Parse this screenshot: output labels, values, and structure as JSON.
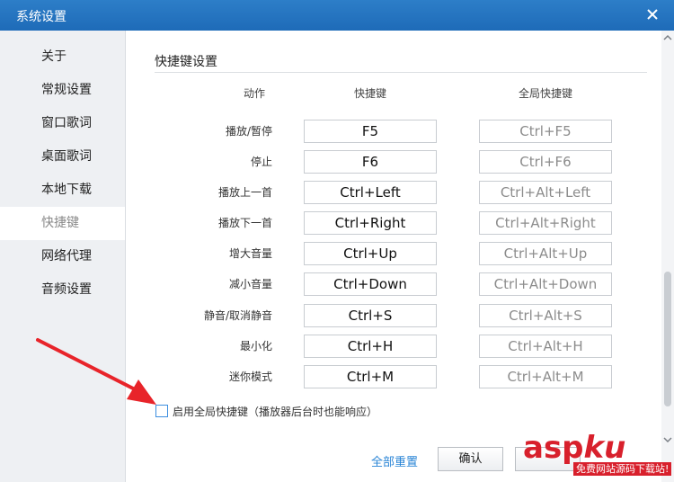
{
  "window": {
    "title": "系统设置",
    "icons": {
      "close": "close-icon"
    }
  },
  "sidebar": {
    "items": [
      {
        "label": "关于"
      },
      {
        "label": "常规设置"
      },
      {
        "label": "窗口歌词"
      },
      {
        "label": "桌面歌词"
      },
      {
        "label": "本地下载"
      },
      {
        "label": "快捷键",
        "active": true
      },
      {
        "label": "网络代理"
      },
      {
        "label": "音频设置"
      }
    ]
  },
  "section": {
    "title": "快捷键设置"
  },
  "table": {
    "headers": {
      "action": "动作",
      "shortcut": "快捷键",
      "global": "全局快捷键"
    },
    "rows": [
      {
        "action": "播放/暂停",
        "shortcut": "F5",
        "global": "Ctrl+F5"
      },
      {
        "action": "停止",
        "shortcut": "F6",
        "global": "Ctrl+F6"
      },
      {
        "action": "播放上一首",
        "shortcut": "Ctrl+Left",
        "global": "Ctrl+Alt+Left"
      },
      {
        "action": "播放下一首",
        "shortcut": "Ctrl+Right",
        "global": "Ctrl+Alt+Right"
      },
      {
        "action": "增大音量",
        "shortcut": "Ctrl+Up",
        "global": "Ctrl+Alt+Up"
      },
      {
        "action": "减小音量",
        "shortcut": "Ctrl+Down",
        "global": "Ctrl+Alt+Down"
      },
      {
        "action": "静音/取消静音",
        "shortcut": "Ctrl+S",
        "global": "Ctrl+Alt+S"
      },
      {
        "action": "最小化",
        "shortcut": "Ctrl+H",
        "global": "Ctrl+Alt+H"
      },
      {
        "action": "迷你模式",
        "shortcut": "Ctrl+M",
        "global": "Ctrl+Alt+M"
      }
    ]
  },
  "global_toggle": {
    "label": "启用全局快捷键（播放器后台时也能响应）",
    "checked": false
  },
  "footer": {
    "reset_label": "全部重置",
    "ok_label": "确认"
  },
  "watermark": {
    "main": "asp",
    "accent": "ku",
    "sub": "免费网站源码下载站!"
  },
  "colors": {
    "titlebar": "#1e6bb8",
    "accent": "#2a85d6",
    "arrow": "#e8242a",
    "watermark": "#d8202c"
  }
}
